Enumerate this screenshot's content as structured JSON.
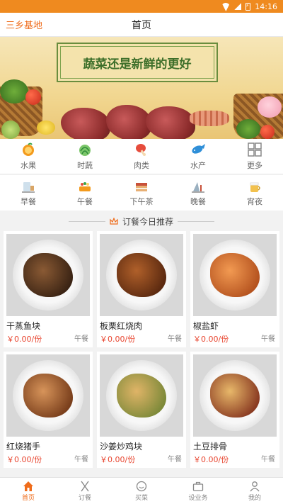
{
  "status": {
    "time": "14:16"
  },
  "header": {
    "city": "三乡基地",
    "title": "首页"
  },
  "banner": {
    "slogan": "蔬菜还是新鲜的更好"
  },
  "categories": [
    {
      "label": "水果",
      "icon": "orange-icon",
      "color": "#f39a1c"
    },
    {
      "label": "时蔬",
      "icon": "cabbage-icon",
      "color": "#3aa54a"
    },
    {
      "label": "肉类",
      "icon": "drumstick-icon",
      "color": "#e64c3c"
    },
    {
      "label": "水产",
      "icon": "fish-icon",
      "color": "#2f8fd8"
    },
    {
      "label": "更多",
      "icon": "grid-icon",
      "color": "#888888"
    }
  ],
  "meals": [
    {
      "label": "早餐",
      "icon": "breakfast-icon"
    },
    {
      "label": "午餐",
      "icon": "lunch-icon"
    },
    {
      "label": "下午茶",
      "icon": "afternoon-tea-icon"
    },
    {
      "label": "晚餐",
      "icon": "dinner-icon"
    },
    {
      "label": "宵夜",
      "icon": "night-snack-icon"
    }
  ],
  "section": {
    "title": "订餐今日推荐"
  },
  "dishes": [
    {
      "name": "干蒸鱼块",
      "price": "￥0.00/份",
      "tag": "午餐",
      "color": "#5a3a22"
    },
    {
      "name": "板栗红烧肉",
      "price": "￥0.00/份",
      "tag": "午餐",
      "color": "#7a3f1c"
    },
    {
      "name": "椒盐虾",
      "price": "￥0.00/份",
      "tag": "午餐",
      "color": "#c8672c"
    },
    {
      "name": "红烧猪手",
      "price": "￥0.00/份",
      "tag": "午餐",
      "color": "#9b5a2e"
    },
    {
      "name": "沙姜炒鸡块",
      "price": "￥0.00/份",
      "tag": "午餐",
      "color": "#b88a3a"
    },
    {
      "name": "土豆排骨",
      "price": "￥0.00/份",
      "tag": "午餐",
      "color": "#8a3b22"
    }
  ],
  "tabbar": [
    {
      "label": "首页",
      "icon": "home-icon",
      "active": true
    },
    {
      "label": "订餐",
      "icon": "cutlery-icon",
      "active": false
    },
    {
      "label": "买菜",
      "icon": "basket-icon",
      "active": false
    },
    {
      "label": "设业务",
      "icon": "briefcase-icon",
      "active": false
    },
    {
      "label": "我的",
      "icon": "user-icon",
      "active": false
    }
  ],
  "colors": {
    "accent": "#ef6c1b",
    "price": "#e8452f"
  }
}
